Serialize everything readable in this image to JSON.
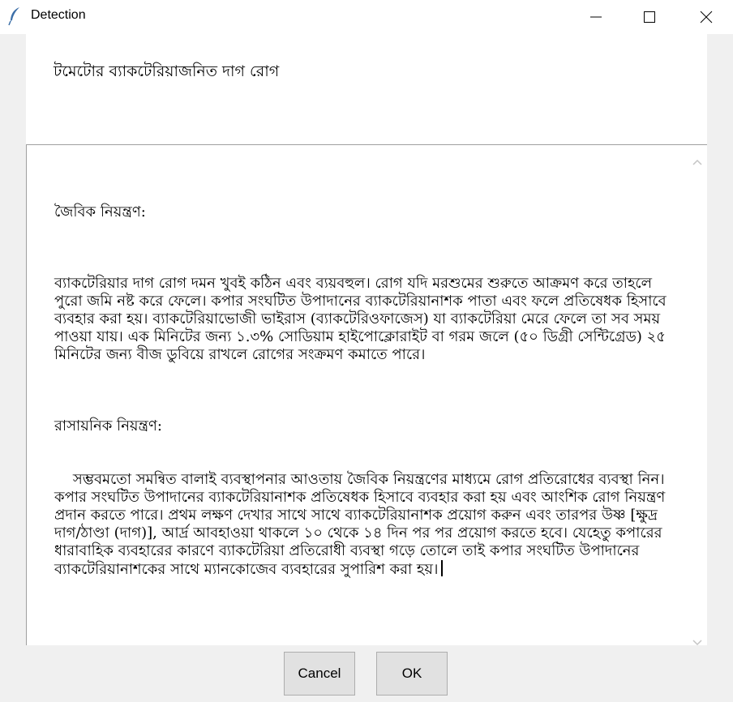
{
  "window": {
    "title": "Detection",
    "icon": "feather-icon"
  },
  "heading": "টমেটোর ব্যাকটেরিয়াজনিত দাগ রোগ",
  "sections": [
    {
      "title": "জৈবিক নিয়ন্ত্রণ:",
      "text": "ব্যাকটেরিয়ার দাগ রোগ দমন খুবই কঠিন এবং ব্যয়বহুল। রোগ যদি মরশুমের শুরুতে আক্রমণ করে তাহলে পুরো জমি নষ্ট করে ফেলে। কপার সংঘটিত উপাদানের ব্যাকটেরিয়ানাশক পাতা এবং ফলে প্রতিষেধক হিসাবে ব্যবহার করা হয়। ব্যাকটেরিয়াভোজী ভাইরাস (ব্যাকটেরিওফাজেস) যা ব্যাকটেরিয়া মেরে ফেলে তা সব সময় পাওয়া যায়। এক মিনিটের জন্য ১.৩% সোডিয়াম হাইপোক্লোরাইট বা গরম জলে (৫০ ডিগ্রী সেন্টিগ্রেড) ২৫ মিনিটের জন্য বীজ ডুবিয়ে রাখলে রোগের সংক্রমণ কমাতে পারে।"
    },
    {
      "title": "রাসায়নিক নিয়ন্ত্রণ:",
      "text": "সম্ভবমতো সমন্বিত বালাই ব্যবস্থাপনার আওতায় জৈবিক নিয়ন্ত্রণের মাধ্যমে রোগ প্রতিরোধের ব্যবস্থা নিন। কপার সংঘটিত উপাদানের ব্যাকটেরিয়ানাশক প্রতিষেধক হিসাবে ব্যবহার করা হয় এবং আংশিক রোগ নিয়ন্ত্রণ প্রদান করতে পারে। প্রথম লক্ষণ দেখার সাথে সাথে ব্যাকটেরিয়ানাশক প্রয়োগ করুন এবং তারপর উষ্ণ [ক্ষুদ্র দাগ/ঠাণ্ডা (দাগ)], আর্দ্র আবহাওয়া থাকলে ১০ থেকে ১৪ দিন পর পর প্রয়োগ করতে হবে। যেহেতু কপারের ধারাবাহিক ব্যবহারের কারণে ব্যাকটেরিয়া প্রতিরোধী ব্যবস্থা গড়ে তোলে তাই কপার সংঘটিত উপাদানের ব্যাকটেরিয়ানাশকের সাথে ম্যানকোজেব ব্যবহারের সুপারিশ করা হয়।"
    }
  ],
  "buttons": {
    "cancel": "Cancel",
    "ok": "OK"
  }
}
